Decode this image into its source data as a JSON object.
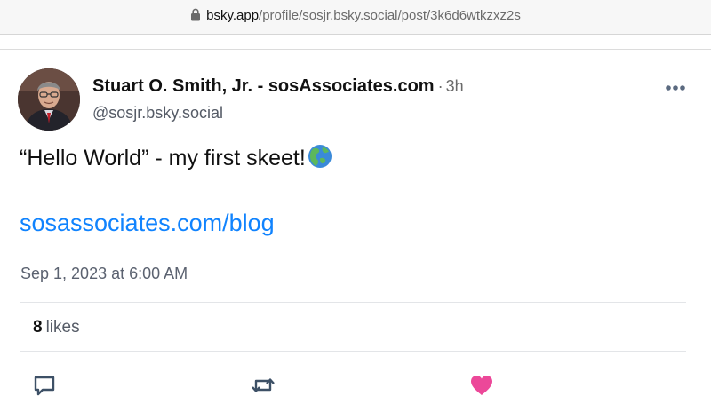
{
  "browser": {
    "url_domain": "bsky.app",
    "url_path": "/profile/sosjr.bsky.social/post/3k6d6wtkzxz2s"
  },
  "post": {
    "author_name": "Stuart O. Smith, Jr. - sosAssociates.com",
    "separator": "·",
    "time_ago": "3h",
    "handle": "@sosjr.bsky.social",
    "text": "“Hello World” - my first skeet!",
    "emoji_icon": "globe-americas-icon",
    "link_text": "sosassociates.com/blog",
    "timestamp": "Sep 1, 2023 at 6:00 AM",
    "like_count": "8",
    "like_label": "likes",
    "liked": true
  },
  "colors": {
    "link": "#1083fe",
    "like_heart": "#ec4899",
    "muted_text": "#5b6270",
    "action_icon": "#3d5066"
  }
}
